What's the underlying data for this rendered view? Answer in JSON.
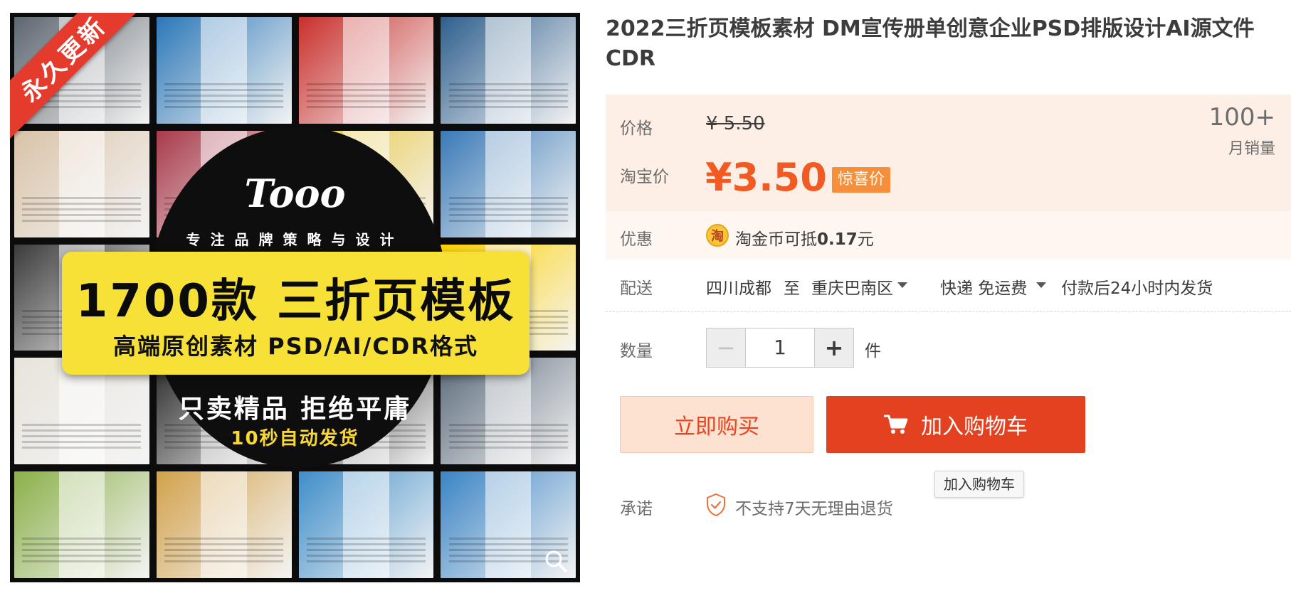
{
  "image": {
    "ribbon": "永久更新",
    "brand_logo": "Tooo",
    "slogan": "专注品牌策略与设计",
    "banner_title": "1700款 三折页模板",
    "banner_sub": "高端原创素材 PSD/AI/CDR格式",
    "promo_line1": "只卖精品 拒绝平庸",
    "promo_line2": "10秒自动发货",
    "zoom_icon": "magnifier-icon",
    "thumb_colors": [
      "#5d6670",
      "#2c78b8",
      "#c9302c",
      "#2f5f8e",
      "#d9c3a8",
      "#a83a4a",
      "#e8c53a",
      "#3a7ab7",
      "#3b3b3b",
      "#2a2a2a",
      "#3b3b3b",
      "#ffd200",
      "#e8e4dc",
      "#2a2a2a",
      "#2a2a2a",
      "#5b6b7b",
      "#8bb04a",
      "#d2a24c",
      "#3f8ec9",
      "#3a84c5"
    ]
  },
  "product": {
    "title": "2022三折页模板素材 DM宣传册单创意企业PSD排版设计AI源文件CDR"
  },
  "price": {
    "label": "价格",
    "original": "¥ 5.50",
    "taobao_label": "淘宝价",
    "current": "¥3.50",
    "tag": "惊喜价",
    "sales_count": "100+",
    "sales_label": "月销量",
    "accent_color": "#f15a22"
  },
  "promo": {
    "label": "优惠",
    "coin_icon_char": "淘",
    "coin_text_prefix": "淘金币可抵",
    "coin_amount": "0.17",
    "coin_unit": "元"
  },
  "shipping": {
    "label": "配送",
    "from": "四川成都",
    "to_word": "至",
    "destination": "重庆巴南区",
    "method": "快递 免运费",
    "note": "付款后24小时内发货"
  },
  "quantity": {
    "label": "数量",
    "minus": "−",
    "value": "1",
    "plus": "+",
    "unit": "件"
  },
  "actions": {
    "buy_now": "立即购买",
    "add_cart": "加入购物车",
    "tooltip": "加入购物车",
    "cart_icon": "cart-icon"
  },
  "promise": {
    "label": "承诺",
    "icon": "shield-icon",
    "text": "不支持7天无理由退货"
  }
}
